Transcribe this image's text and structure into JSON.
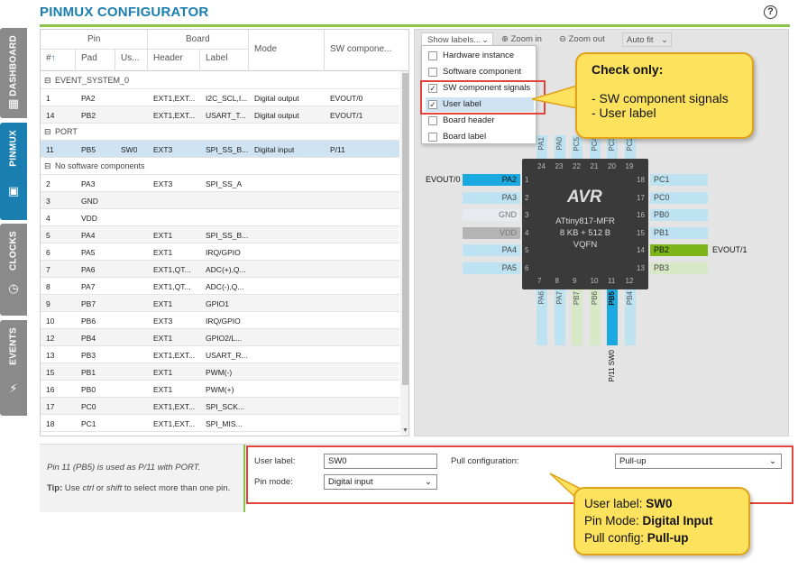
{
  "app": {
    "title": "PINMUX CONFIGURATOR",
    "help": "?"
  },
  "sidetabs": [
    {
      "label": "DASHBOARD",
      "icon": "dashboard-icon"
    },
    {
      "label": "PINMUX",
      "icon": "chip-icon"
    },
    {
      "label": "CLOCKS",
      "icon": "clock-icon"
    },
    {
      "label": "EVENTS",
      "icon": "lightning-icon"
    }
  ],
  "table": {
    "group_headers": {
      "pin": "Pin",
      "board": "Board"
    },
    "columns": [
      "#",
      "Pad",
      "Us...",
      "Header",
      "Label",
      "Mode",
      "SW compone..."
    ],
    "sort_indicator": "↑",
    "groups": [
      {
        "name": "EVENT_SYSTEM_0",
        "rows": [
          {
            "num": "1",
            "pad": "PA2",
            "us": "",
            "header": "EXT1,EXT...",
            "label": "I2C_SCL,I...",
            "mode": "Digital output",
            "sw": "EVOUT/0"
          },
          {
            "num": "14",
            "pad": "PB2",
            "us": "",
            "header": "EXT1,EXT...",
            "label": "USART_T...",
            "mode": "Digital output",
            "sw": "EVOUT/1"
          }
        ]
      },
      {
        "name": "PORT",
        "rows": [
          {
            "num": "11",
            "pad": "PB5",
            "us": "SW0",
            "header": "EXT3",
            "label": "SPI_SS_B...",
            "mode": "Digital input",
            "sw": "P/11"
          }
        ]
      },
      {
        "name": "No software components",
        "rows": [
          {
            "num": "2",
            "pad": "PA3",
            "us": "",
            "header": "EXT3",
            "label": "SPI_SS_A",
            "mode": "",
            "sw": ""
          },
          {
            "num": "3",
            "pad": "GND",
            "us": "",
            "header": "",
            "label": "",
            "mode": "",
            "sw": ""
          },
          {
            "num": "4",
            "pad": "VDD",
            "us": "",
            "header": "",
            "label": "",
            "mode": "",
            "sw": ""
          },
          {
            "num": "5",
            "pad": "PA4",
            "us": "",
            "header": "EXT1",
            "label": "SPI_SS_B...",
            "mode": "",
            "sw": ""
          },
          {
            "num": "6",
            "pad": "PA5",
            "us": "",
            "header": "EXT1",
            "label": "IRQ/GPIO",
            "mode": "",
            "sw": ""
          },
          {
            "num": "7",
            "pad": "PA6",
            "us": "",
            "header": "EXT1,QT...",
            "label": "ADC(+),Q...",
            "mode": "",
            "sw": ""
          },
          {
            "num": "8",
            "pad": "PA7",
            "us": "",
            "header": "EXT1,QT...",
            "label": "ADC(-),Q...",
            "mode": "",
            "sw": ""
          },
          {
            "num": "9",
            "pad": "PB7",
            "us": "",
            "header": "EXT1",
            "label": "GPIO1",
            "mode": "",
            "sw": ""
          },
          {
            "num": "10",
            "pad": "PB6",
            "us": "",
            "header": "EXT3",
            "label": "IRQ/GPIO",
            "mode": "",
            "sw": ""
          },
          {
            "num": "12",
            "pad": "PB4",
            "us": "",
            "header": "EXT1",
            "label": "GPIO2/L...",
            "mode": "",
            "sw": ""
          },
          {
            "num": "13",
            "pad": "PB3",
            "us": "",
            "header": "EXT1,EXT...",
            "label": "USART_R...",
            "mode": "",
            "sw": ""
          },
          {
            "num": "15",
            "pad": "PB1",
            "us": "",
            "header": "EXT1",
            "label": "PWM(-)",
            "mode": "",
            "sw": ""
          },
          {
            "num": "16",
            "pad": "PB0",
            "us": "",
            "header": "EXT1",
            "label": "PWM(+)",
            "mode": "",
            "sw": ""
          },
          {
            "num": "17",
            "pad": "PC0",
            "us": "",
            "header": "EXT1,EXT...",
            "label": "SPI_SCK...",
            "mode": "",
            "sw": ""
          },
          {
            "num": "18",
            "pad": "PC1",
            "us": "",
            "header": "EXT1,EXT...",
            "label": "SPI_MIS...",
            "mode": "",
            "sw": ""
          }
        ]
      }
    ]
  },
  "toolbar": {
    "show_labels": "Show labels...",
    "zoom_in": "Zoom in",
    "zoom_out": "Zoom out",
    "auto_fit": "Auto fit"
  },
  "labels_menu": [
    {
      "label": "Hardware instance",
      "checked": false
    },
    {
      "label": "Software component",
      "checked": false
    },
    {
      "label": "SW component signals",
      "checked": true
    },
    {
      "label": "User label",
      "checked": true
    },
    {
      "label": "Board header",
      "checked": false
    },
    {
      "label": "Board label",
      "checked": false
    }
  ],
  "callout_top": {
    "title": "Check only:",
    "line1": "- SW component signals",
    "line2": "- User label"
  },
  "chip": {
    "logo": "AVR",
    "name": "ATtiny817-MFR",
    "memory": "8 KB + 512 B",
    "package": "VQFN"
  },
  "pins_left": [
    {
      "num": "1",
      "pad": "PA2",
      "signal": "EVOUT/0"
    },
    {
      "num": "2",
      "pad": "PA3",
      "signal": ""
    },
    {
      "num": "3",
      "pad": "GND",
      "signal": ""
    },
    {
      "num": "4",
      "pad": "VDD",
      "signal": ""
    },
    {
      "num": "5",
      "pad": "PA4",
      "signal": ""
    },
    {
      "num": "6",
      "pad": "PA5",
      "signal": ""
    }
  ],
  "pins_right": [
    {
      "num": "18",
      "pad": "PC1",
      "signal": ""
    },
    {
      "num": "17",
      "pad": "PC0",
      "signal": ""
    },
    {
      "num": "16",
      "pad": "PB0",
      "signal": ""
    },
    {
      "num": "15",
      "pad": "PB1",
      "signal": ""
    },
    {
      "num": "14",
      "pad": "PB2",
      "signal": "EVOUT/1"
    },
    {
      "num": "13",
      "pad": "PB3",
      "signal": ""
    }
  ],
  "pins_top": [
    {
      "num": "24",
      "pad": "PA1"
    },
    {
      "num": "23",
      "pad": "PA0"
    },
    {
      "num": "22",
      "pad": "PC5"
    },
    {
      "num": "21",
      "pad": "PC4"
    },
    {
      "num": "20",
      "pad": "PC3"
    },
    {
      "num": "19",
      "pad": "PC2"
    }
  ],
  "pins_bottom": [
    {
      "num": "7",
      "pad": "PA6",
      "signal": ""
    },
    {
      "num": "8",
      "pad": "PA7",
      "signal": ""
    },
    {
      "num": "9",
      "pad": "PB7",
      "signal": ""
    },
    {
      "num": "10",
      "pad": "PB6",
      "signal": ""
    },
    {
      "num": "11",
      "pad": "PB5",
      "signal": "P/11 SW0"
    },
    {
      "num": "12",
      "pad": "PB4",
      "signal": ""
    }
  ],
  "pin_colors": {
    "blue": "#bde3f3",
    "selected": "#1aa9e0",
    "green": "#7cb518",
    "lightgreen": "#d6e8c6",
    "gray": "#b4b4b4",
    "white": "#e8eaf0"
  },
  "bottom": {
    "info_pre": "Pin 11 (PB5) is used as ",
    "info_sig": "P/11",
    "info_mid": " with ",
    "info_comp": "PORT",
    "info_end": ".",
    "tip_label": "Tip:",
    "tip_pre": " Use ",
    "tip_ctrl": "ctrl",
    "tip_or": " or ",
    "tip_shift": "shift",
    "tip_post": " to select more than one pin.",
    "user_label_lbl": "User label:",
    "user_label_val": "SW0",
    "pin_mode_lbl": "Pin mode:",
    "pin_mode_val": "Digital input",
    "pull_lbl": "Pull configuration:",
    "pull_val": "Pull-up"
  },
  "callout_bottom": {
    "l1a": "User label: ",
    "l1b": "SW0",
    "l2a": "Pin Mode: ",
    "l2b": "Digital Input",
    "l3a": "Pull config: ",
    "l3b": "Pull-up"
  }
}
